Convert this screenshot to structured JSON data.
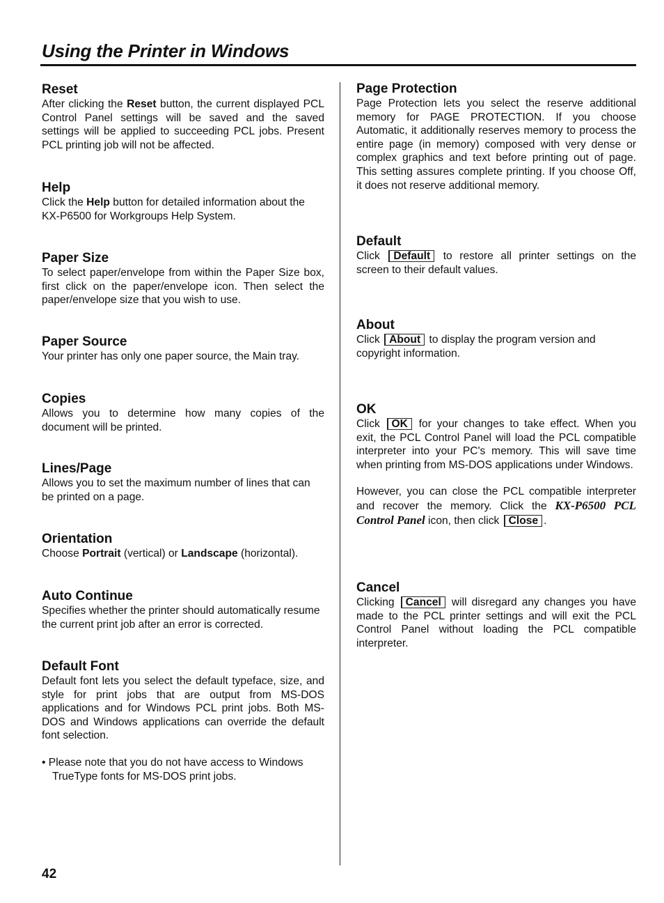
{
  "header": {
    "title": "Using the Printer in Windows"
  },
  "left_column": {
    "reset": {
      "heading": "Reset",
      "t1": "After clicking the ",
      "b1": "Reset",
      "t2": " button, the current displayed PCL Control Panel settings will be saved and the saved settings will be applied to succeeding PCL jobs. Present PCL printing job will not be affected."
    },
    "help": {
      "heading": "Help",
      "t1": "Click the ",
      "b1": "Help",
      "t2": " button for detailed information about the KX-P6500 for Workgroups Help System."
    },
    "paper_size": {
      "heading": "Paper Size",
      "body": "To select paper/envelope from within the Paper Size box, first click on the paper/envelope icon. Then select the paper/envelope size that you wish to use."
    },
    "paper_source": {
      "heading": "Paper Source",
      "body": "Your printer has only one paper source, the Main tray."
    },
    "copies": {
      "heading": "Copies",
      "body": "Allows you to determine how many copies of the document will be printed."
    },
    "lines_page": {
      "heading": "Lines/Page",
      "body": "Allows you to set the maximum number of lines that can be printed on a page."
    },
    "orientation": {
      "heading": "Orientation",
      "t1": "Choose ",
      "b1": "Portrait",
      "t2": " (vertical) or ",
      "b2": "Landscape",
      "t3": " (horizontal)."
    },
    "auto_continue": {
      "heading": "Auto Continue",
      "body": "Specifies whether the printer should automatically resume the current print job after an error is corrected."
    },
    "default_font": {
      "heading": "Default Font",
      "body": "Default font lets you select the default typeface, size, and style for print jobs that are output from MS-DOS applications and for Windows PCL print jobs. Both MS-DOS and Windows applications can override the default font selection.",
      "bullet": "• Please note that you do not have access to Windows TrueType fonts for MS-DOS print jobs."
    }
  },
  "right_column": {
    "page_protection": {
      "heading": "Page Protection",
      "body": "Page Protection lets you select the reserve additional memory for PAGE PROTECTION. If you choose Automatic, it additionally reserves memory to process the entire page (in memory) composed with very dense or complex graphics and text before printing out of page. This setting assures complete printing. If you choose Off, it does not reserve additional memory."
    },
    "default": {
      "heading": "Default",
      "t1": "Click ",
      "button": "Default",
      "t2": " to restore all printer settings on the screen to their default values."
    },
    "about": {
      "heading": "About",
      "t1": "Click ",
      "button": "About",
      "t2": " to display the program version and copyright information."
    },
    "ok": {
      "heading": "OK",
      "t1": "Click ",
      "button": "OK",
      "t2": " for your changes to take effect. When you exit, the PCL Control Panel will load the PCL compatible interpreter into your PC's memory. This will save time when printing from MS-DOS applications under Windows.",
      "p2_t1": "However, you can close the PCL compatible interpreter and recover the memory. Click the ",
      "p2_em": "KX-P6500 PCL Control Panel",
      "p2_t2": " icon, then click ",
      "p2_button": "Close",
      "p2_t3": "."
    },
    "cancel": {
      "heading": "Cancel",
      "t1": "Clicking ",
      "button": "Cancel",
      "t2": " will disregard any changes you have made to the PCL printer settings and will exit the PCL Control Panel without loading the PCL compatible interpreter."
    }
  },
  "footer": {
    "page_number": "42"
  }
}
